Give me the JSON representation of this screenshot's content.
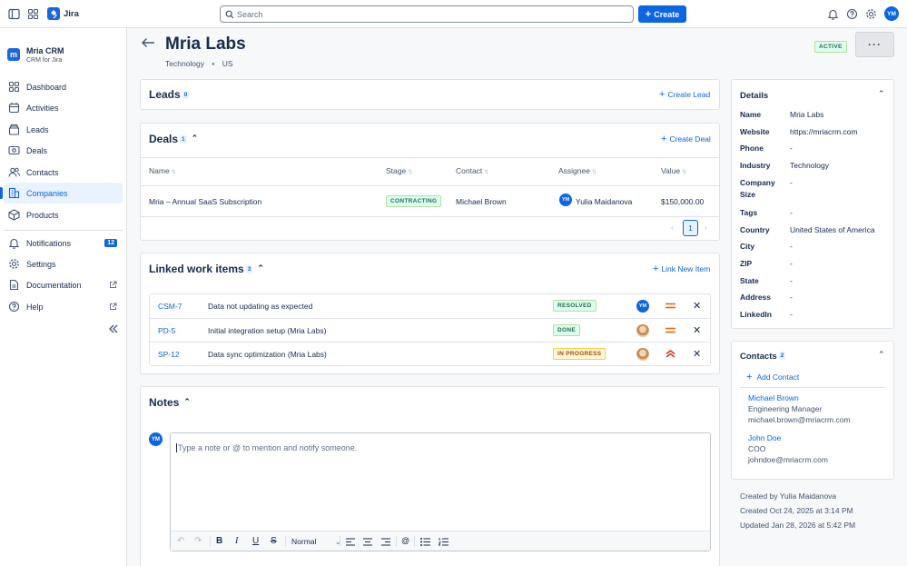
{
  "topbar": {
    "app_name": "Jira",
    "search_placeholder": "Search",
    "create_label": "Create",
    "user_initials": "YM"
  },
  "sidebar": {
    "app_title": "Mria CRM",
    "app_subtitle": "CRM for Jira",
    "items": [
      {
        "label": "Dashboard",
        "icon": "dashboard-icon"
      },
      {
        "label": "Activities",
        "icon": "activities-icon"
      },
      {
        "label": "Leads",
        "icon": "leads-icon"
      },
      {
        "label": "Deals",
        "icon": "deals-icon"
      },
      {
        "label": "Contacts",
        "icon": "contacts-icon"
      },
      {
        "label": "Companies",
        "icon": "companies-icon",
        "active": true
      },
      {
        "label": "Products",
        "icon": "products-icon"
      }
    ],
    "secondary": [
      {
        "label": "Notifications",
        "badge": "12"
      },
      {
        "label": "Settings"
      },
      {
        "label": "Documentation"
      },
      {
        "label": "Help"
      }
    ]
  },
  "company": {
    "name": "Mria Labs",
    "industry": "Technology",
    "country": "US",
    "status": "ACTIVE"
  },
  "leads": {
    "title": "Leads",
    "count": "0",
    "action": "Create Lead"
  },
  "deals": {
    "title": "Deals",
    "count": "1",
    "action": "Create Deal",
    "columns": [
      "Name",
      "Stage",
      "Contact",
      "Assignee",
      "Value"
    ],
    "rows": [
      {
        "name": "Mria – Annual SaaS Subscription",
        "stage": "CONTRACTING",
        "contact": "Michael Brown",
        "assignee_initials": "YM",
        "assignee": "Yulia Maidanova",
        "value": "$150,000.00"
      }
    ],
    "page": "1"
  },
  "linked": {
    "title": "Linked work items",
    "count": "3",
    "action": "Link New Item",
    "items": [
      {
        "key": "CSM-7",
        "summary": "Data not updating as expected",
        "status": "RESOLVED",
        "assignee_initials": "YM",
        "priority": "medium"
      },
      {
        "key": "PD-5",
        "summary": "Initial integration setup (Mria Labs)",
        "status": "DONE",
        "priority": "medium"
      },
      {
        "key": "SP-12",
        "summary": "Data sync optimization (Mria Labs)",
        "status": "IN PROGRESS",
        "priority": "high"
      }
    ]
  },
  "notes": {
    "title": "Notes",
    "user_initials": "YM",
    "placeholder": "Type a note or @ to mention and notify someone.",
    "text_style": "Normal"
  },
  "details": {
    "title": "Details",
    "fields": [
      {
        "label": "Name",
        "value": "Mria Labs"
      },
      {
        "label": "Website",
        "value": "https://mriacrm.com"
      },
      {
        "label": "Phone",
        "value": "-"
      },
      {
        "label": "Industry",
        "value": "Technology"
      },
      {
        "label": "Company Size",
        "value": "-"
      },
      {
        "label": "Tags",
        "value": "-"
      },
      {
        "label": "Country",
        "value": "United States of America"
      },
      {
        "label": "City",
        "value": "-"
      },
      {
        "label": "ZIP",
        "value": "-"
      },
      {
        "label": "State",
        "value": "-"
      },
      {
        "label": "Address",
        "value": "-"
      },
      {
        "label": "LinkedIn",
        "value": "-"
      }
    ]
  },
  "contacts": {
    "title": "Contacts",
    "count": "2",
    "action": "Add Contact",
    "list": [
      {
        "name": "Michael Brown",
        "role": "Engineering Manager",
        "email": "michael.brown@mriacrm.com"
      },
      {
        "name": "John Doe",
        "role": "COO",
        "email": "johndoe@mriacrm.com"
      }
    ]
  },
  "meta": {
    "created_by": "Created by Yulia Maidanova",
    "created": "Created Oct 24, 2025 at 3:14 PM",
    "updated": "Updated Jan 28, 2026 at 5:42 PM"
  },
  "colors": {
    "accent": "#0c66e4",
    "status_green": "#216e4e",
    "status_amber": "#a54800",
    "priority_medium": "#e56910",
    "priority_high": "#c9372c"
  }
}
